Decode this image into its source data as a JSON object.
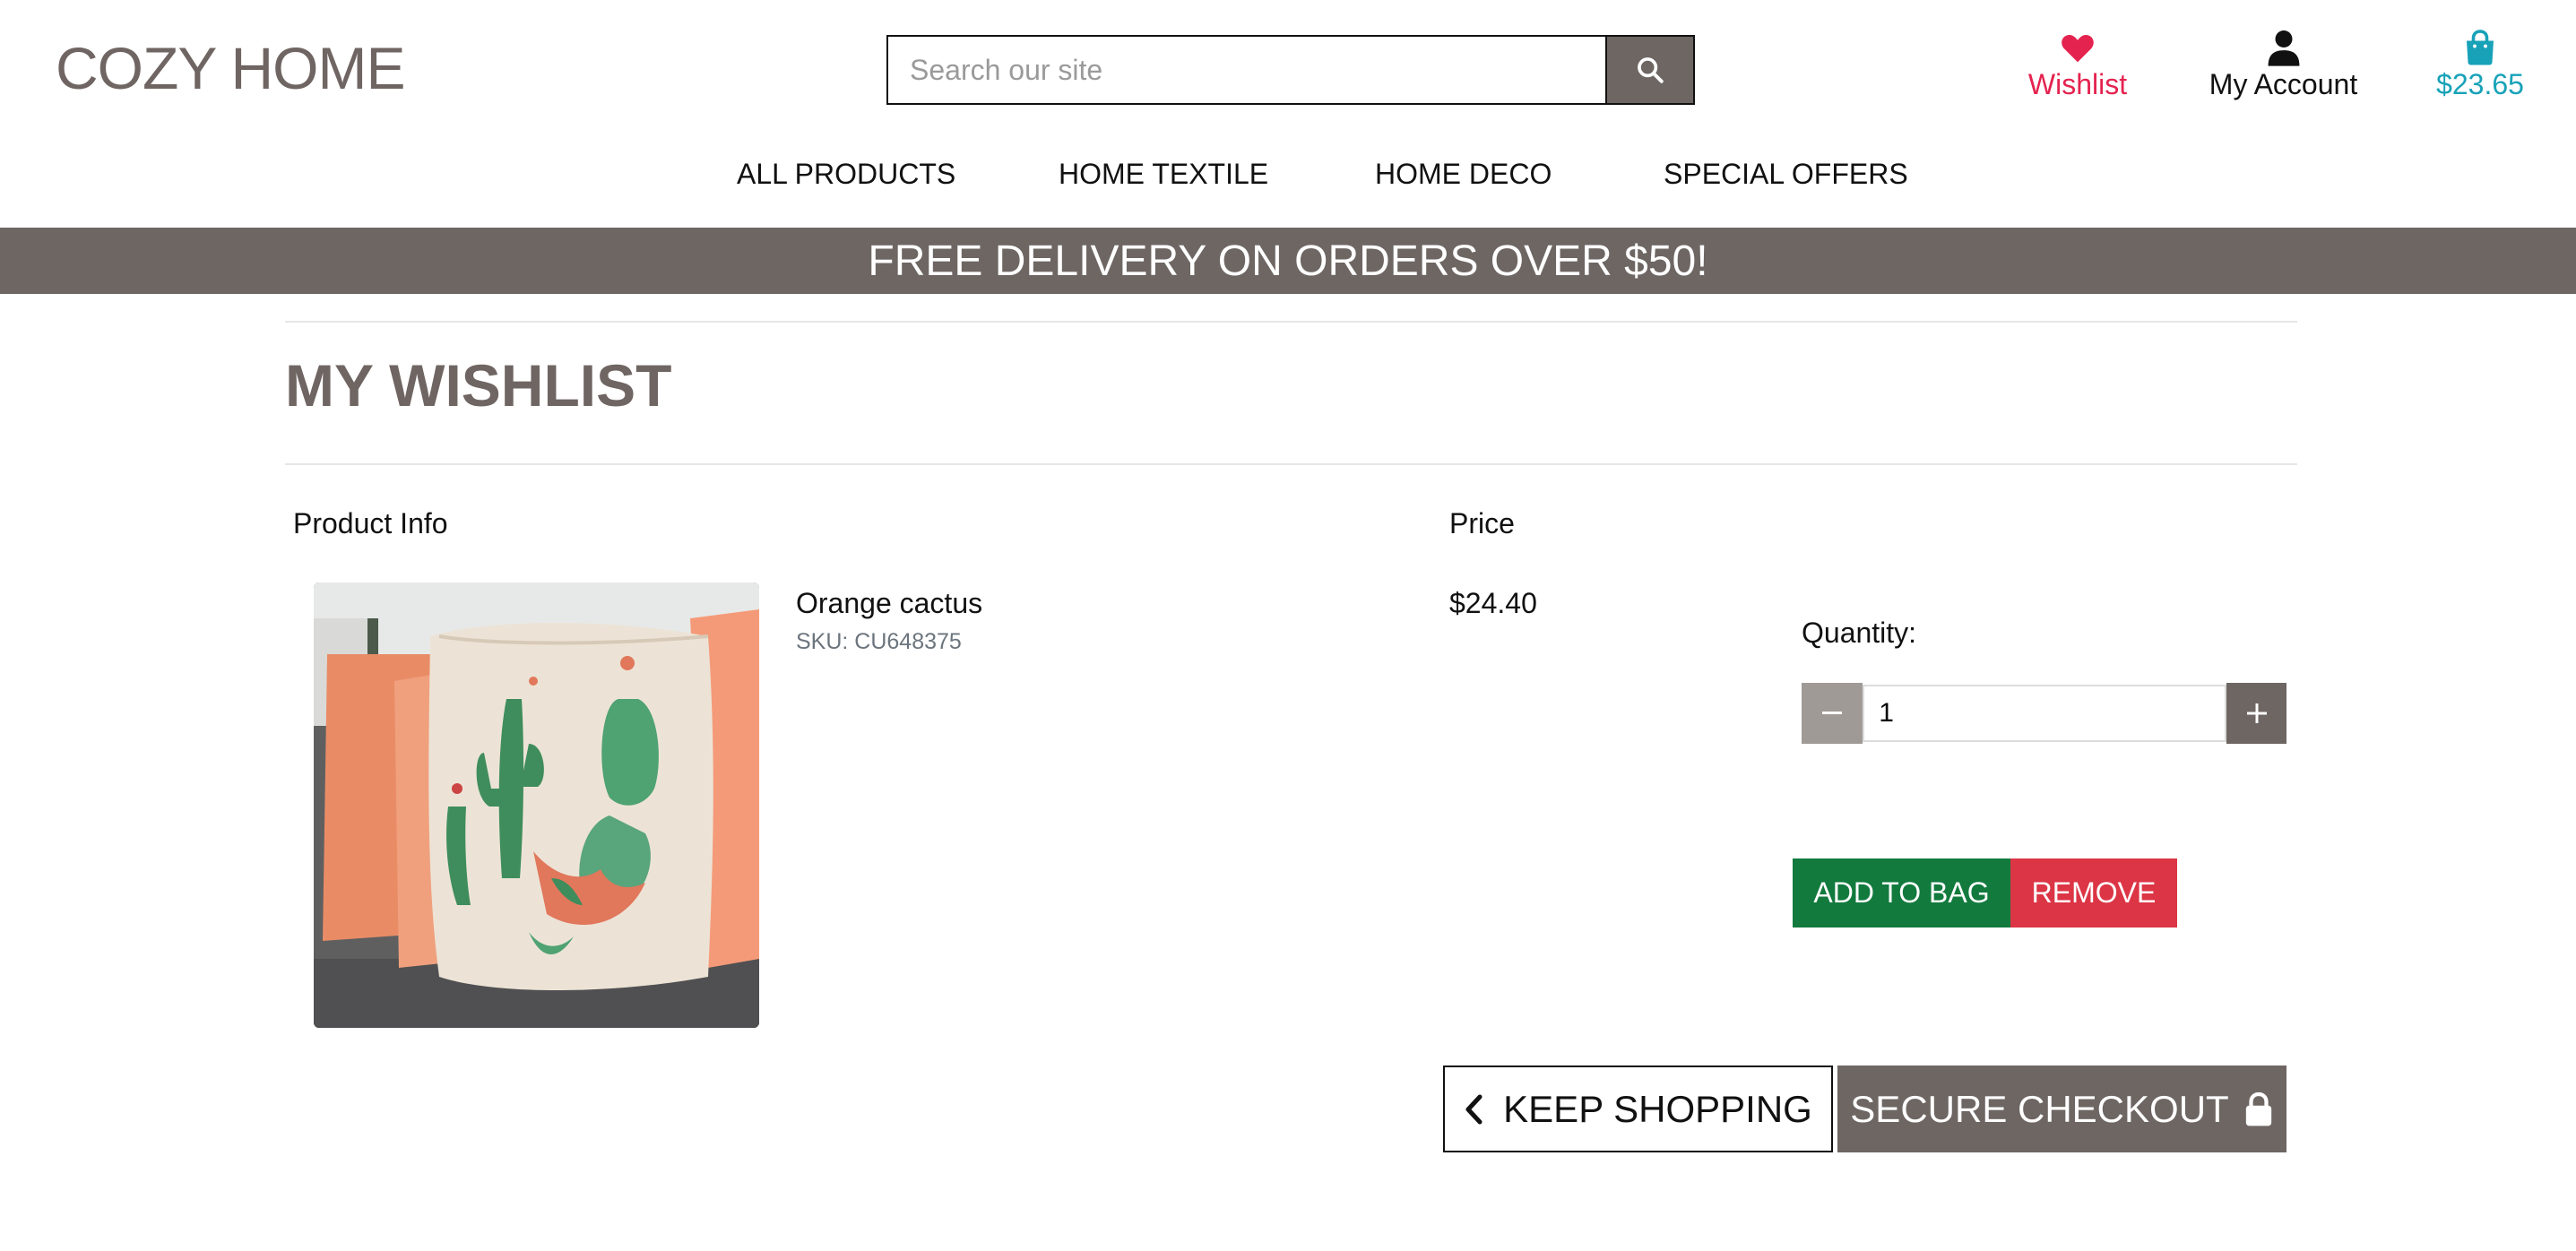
{
  "header": {
    "logo": "COZY HOME",
    "search_placeholder": "Search our site",
    "wishlist_label": "Wishlist",
    "account_label": "My Account",
    "bag_total": "$23.65"
  },
  "nav": {
    "items": [
      "ALL PRODUCTS",
      "HOME TEXTILE",
      "HOME DECO",
      "SPECIAL OFFERS"
    ]
  },
  "banner": "FREE DELIVERY ON ORDERS OVER $50!",
  "page_title": "MY WISHLIST",
  "table": {
    "col_product": "Product Info",
    "col_price": "Price"
  },
  "item": {
    "name": "Orange cactus",
    "sku": "SKU: CU648375",
    "price": "$24.40",
    "quantity_label": "Quantity:",
    "quantity": "1",
    "add_to_bag": "ADD TO BAG",
    "remove": "REMOVE"
  },
  "actions": {
    "keep_shopping": "KEEP SHOPPING",
    "secure_checkout": "SECURE CHECKOUT"
  },
  "colors": {
    "brand_taupe": "#6d6663",
    "wishlist_pink": "#e4234f",
    "bag_teal": "#17a2b8",
    "add_green": "#127a3d",
    "remove_red": "#dc3545"
  }
}
